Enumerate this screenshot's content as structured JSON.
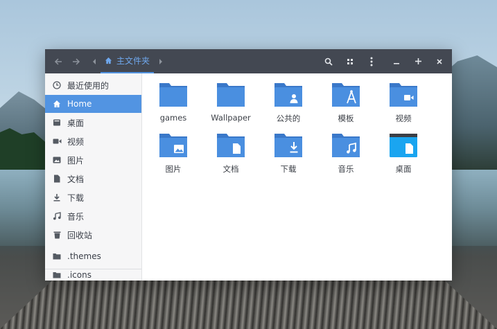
{
  "headerbar": {
    "breadcrumb_label": "主文件夹"
  },
  "sidebar": {
    "items": [
      {
        "label": "最近使用的",
        "icon": "clock-icon"
      },
      {
        "label": "Home",
        "icon": "home-icon",
        "active": true
      },
      {
        "label": "桌面",
        "icon": "desktop-icon"
      },
      {
        "label": "视频",
        "icon": "video-camera-icon"
      },
      {
        "label": "图片",
        "icon": "image-icon"
      },
      {
        "label": "文档",
        "icon": "document-icon"
      },
      {
        "label": "下载",
        "icon": "download-icon"
      },
      {
        "label": "音乐",
        "icon": "music-note-icon"
      },
      {
        "label": "回收站",
        "icon": "trash-icon"
      },
      {
        "label": ".themes",
        "icon": "folder-icon"
      },
      {
        "label": ".icons",
        "icon": "folder-icon"
      }
    ]
  },
  "files": [
    {
      "label": "games",
      "emblem": "none"
    },
    {
      "label": "Wallpaper",
      "emblem": "none"
    },
    {
      "label": "公共的",
      "emblem": "person-icon"
    },
    {
      "label": "模板",
      "emblem": "template-icon"
    },
    {
      "label": "视频",
      "emblem": "video-camera-icon"
    },
    {
      "label": "图片",
      "emblem": "image-icon"
    },
    {
      "label": "文档",
      "emblem": "document-icon"
    },
    {
      "label": "下载",
      "emblem": "download-icon"
    },
    {
      "label": "音乐",
      "emblem": "music-note-icon"
    },
    {
      "label": "桌面",
      "emblem": "desktop-icon"
    }
  ],
  "colors": {
    "headerbar": "#434852",
    "accent": "#5294e2",
    "folder_front": "#4a8fe0",
    "folder_back": "#3a78c9",
    "desktop_folder": "#1aa5f0",
    "sidebar_bg": "#f6f6f7"
  }
}
